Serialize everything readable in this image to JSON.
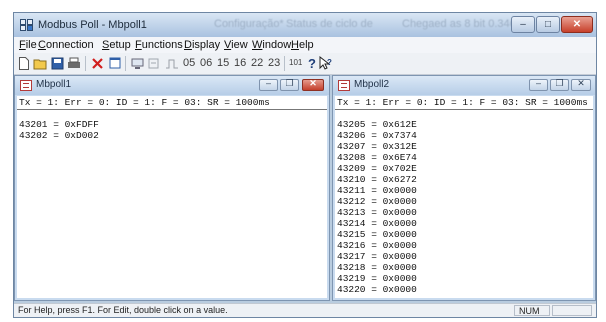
{
  "app": {
    "title": "Modbus Poll - Mbpoll1",
    "ghost_title_1": "Configuração*",
    "ghost_title_2": "Status de ciclo de",
    "ghost_title_3": "Chegaed as 8 bit 0.346",
    "minimize_icon": "minimize-icon",
    "maximize_icon": "maximize-icon",
    "close_icon": "close-icon"
  },
  "menu": [
    {
      "key": "F",
      "rest": "ile"
    },
    {
      "key": "C",
      "rest": "onnection"
    },
    {
      "key": "S",
      "rest": "etup"
    },
    {
      "key": "F",
      "rest": "unctions"
    },
    {
      "key": "D",
      "rest": "isplay"
    },
    {
      "key": "V",
      "rest": "iew"
    },
    {
      "key": "W",
      "rest": "indow"
    },
    {
      "key": "H",
      "rest": "elp"
    }
  ],
  "toolbar": {
    "function_codes": [
      "05",
      "06",
      "15",
      "16",
      "22",
      "23"
    ],
    "code_101": "101",
    "icons": [
      "new-icon",
      "open-icon",
      "save-icon",
      "print-icon",
      "delete-icon",
      "window-icon",
      "connect-icon",
      "disconnect-icon",
      "pulse-icon",
      "help-icon",
      "context-help-icon"
    ]
  },
  "windows": [
    {
      "name": "Mbpoll1",
      "status": "Tx = 1: Err = 0: ID = 1: F = 03: SR = 1000ms",
      "registers": [
        "43201 = 0xFDFF",
        "43202 = 0xD002"
      ]
    },
    {
      "name": "Mbpoll2",
      "status": "Tx = 1: Err = 0: ID = 1: F = 03: SR = 1000ms",
      "registers": [
        "43205 = 0x612E",
        "43206 = 0x7374",
        "43207 = 0x312E",
        "43208 = 0x6E74",
        "43209 = 0x702E",
        "43210 = 0x6272",
        "43211 = 0x0000",
        "43212 = 0x0000",
        "43213 = 0x0000",
        "43214 = 0x0000",
        "43215 = 0x0000",
        "43216 = 0x0000",
        "43217 = 0x0000",
        "43218 = 0x0000",
        "43219 = 0x0000",
        "43220 = 0x0000"
      ]
    }
  ],
  "statusbar": {
    "help_text": "For Help, press F1.  For Edit, double click on a value.",
    "num_indicator": "NUM"
  },
  "colors": {
    "accent_titlebar": "#a9c2e0",
    "close_red": "#c7402b",
    "mdi_background": "#b9ccdf"
  }
}
